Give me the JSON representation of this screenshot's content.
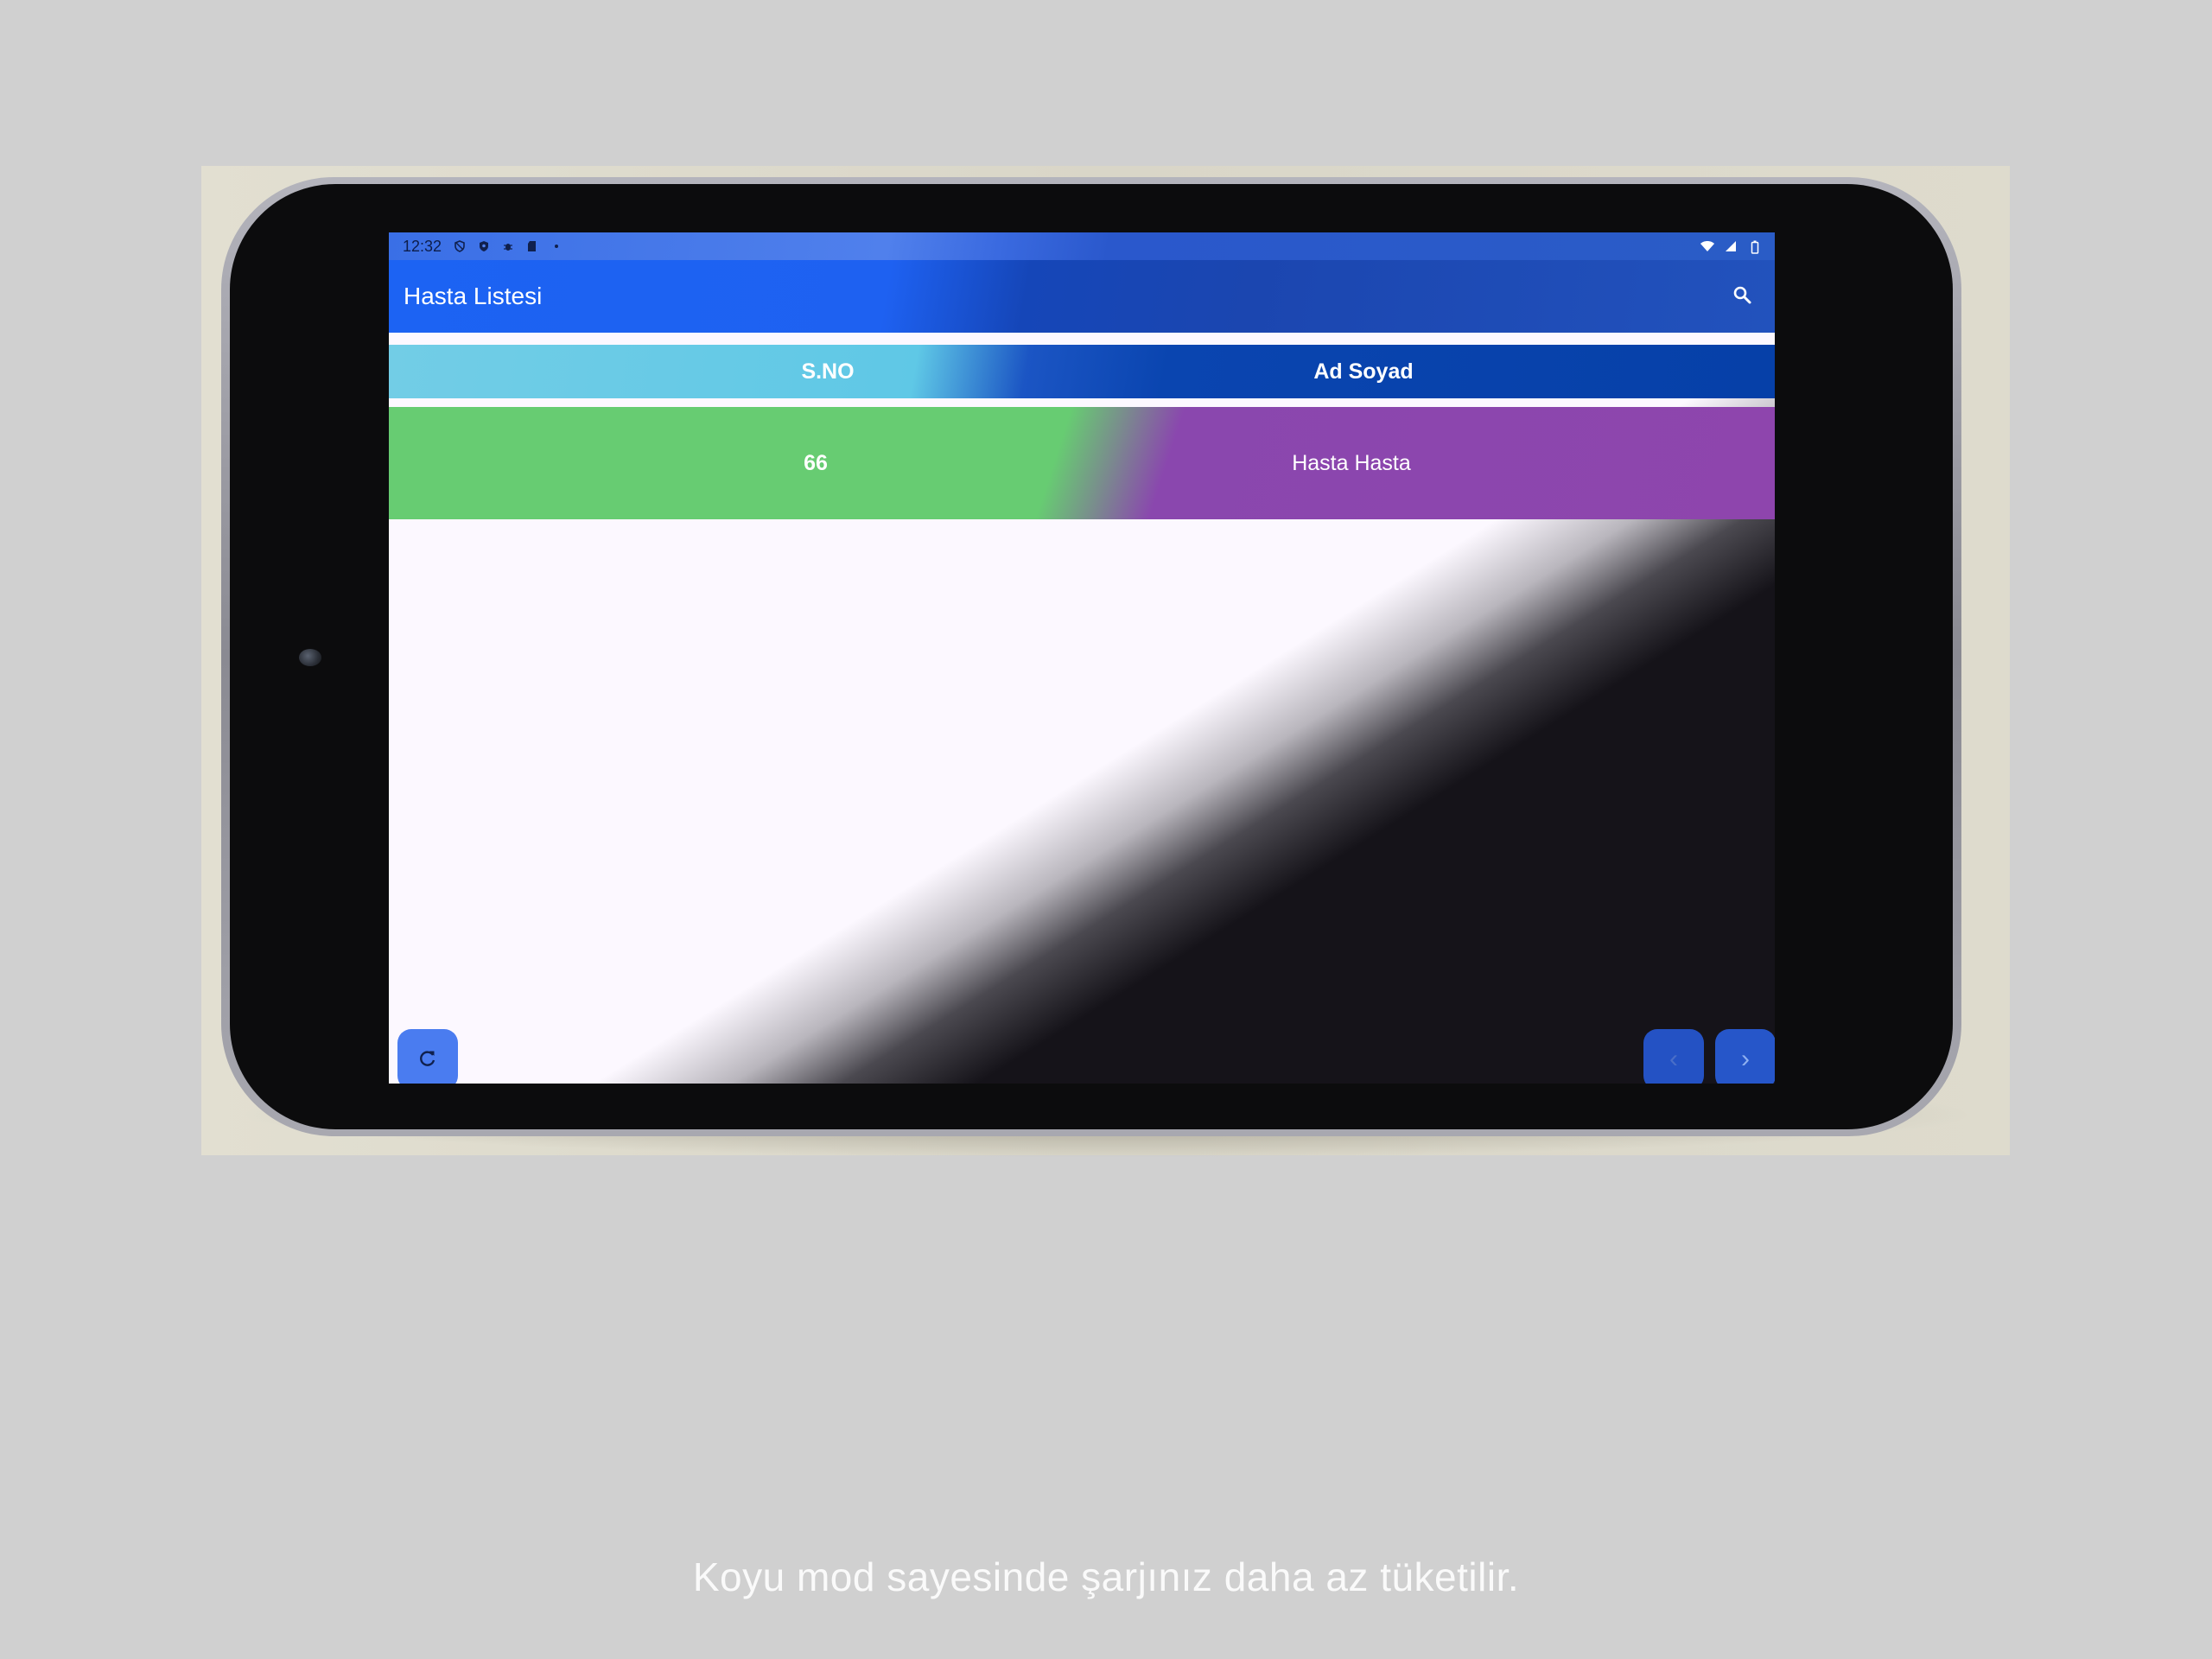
{
  "status_bar": {
    "time": "12:32",
    "left_icons": [
      "vpn-icon",
      "shield-icon",
      "debug-icon",
      "sd-card-icon",
      "dot-icon"
    ],
    "right_icons": [
      "wifi-icon",
      "signal-icon",
      "battery-icon"
    ]
  },
  "app_bar": {
    "title": "Hasta Listesi",
    "search_icon": "search-icon"
  },
  "table": {
    "headers": {
      "sno": "S.NO",
      "name": "Ad Soyad"
    },
    "rows": [
      {
        "sno": "66",
        "name": "Hasta Hasta"
      }
    ]
  },
  "fabs": {
    "refresh_icon": "refresh-icon",
    "prev_icon": "chevron-left-icon",
    "prev_glyph": "‹",
    "next_icon": "chevron-right-icon",
    "next_glyph": "›"
  },
  "caption": "Koyu mod sayesinde şarjınız daha az tüketilir.",
  "colors": {
    "light_header": "#5fc8e6",
    "dark_header": "#0640a8",
    "light_row": "#67cc72",
    "dark_row": "#8e45ad",
    "light_bg": "#fcf8ff",
    "dark_bg": "#151319"
  }
}
